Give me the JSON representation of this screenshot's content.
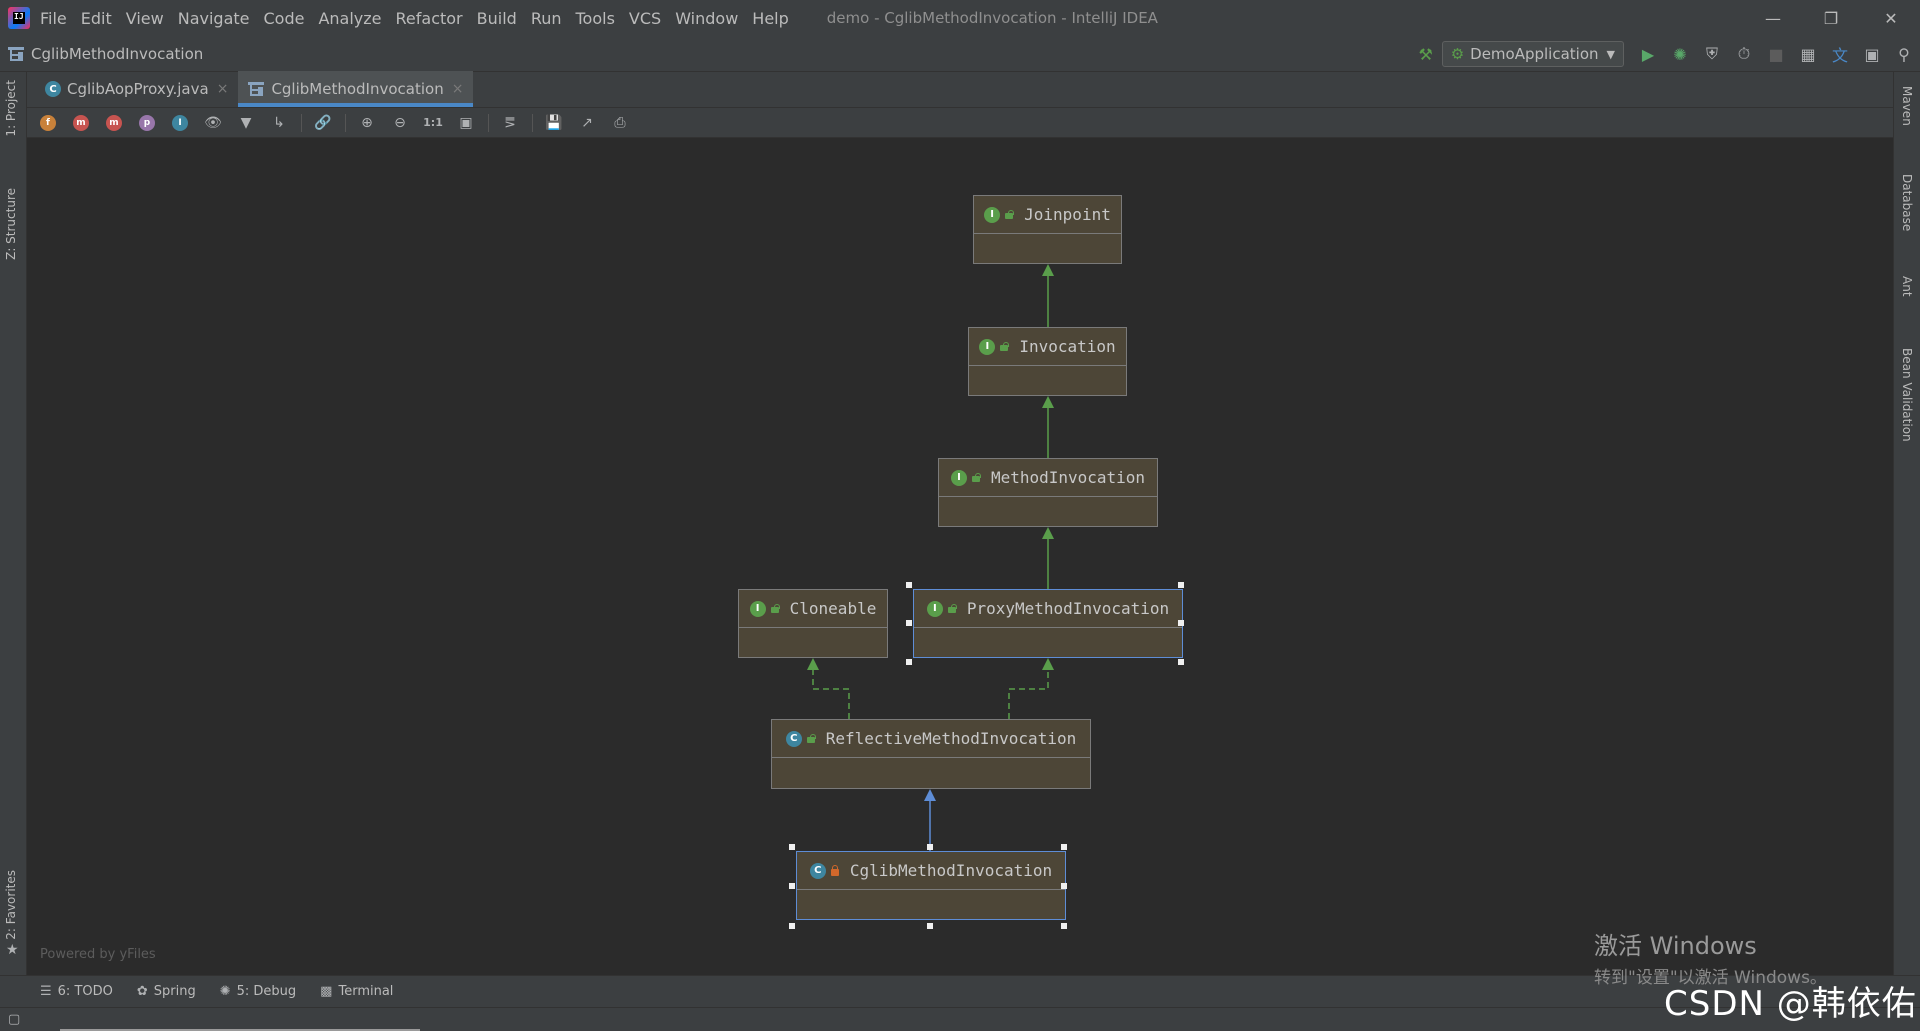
{
  "window": {
    "title": "demo - CglibMethodInvocation - IntelliJ IDEA",
    "menu": [
      "File",
      "Edit",
      "View",
      "Navigate",
      "Code",
      "Analyze",
      "Refactor",
      "Build",
      "Run",
      "Tools",
      "VCS",
      "Window",
      "Help"
    ]
  },
  "navbar": {
    "breadcrumb": "CglibMethodInvocation",
    "run_config": "DemoApplication"
  },
  "left_tools": [
    "1: Project",
    "Z: Structure",
    "2: Favorites"
  ],
  "right_tools": [
    "Maven",
    "Database",
    "Ant",
    "Bean Validation"
  ],
  "tabs": [
    {
      "label": "CglibAopProxy.java",
      "close": "×",
      "active": false
    },
    {
      "label": "CglibMethodInvocation",
      "close": "×",
      "active": true
    }
  ],
  "diagram_toolbar": {
    "icons": [
      "fields-icon",
      "constructors-icon",
      "methods-icon",
      "properties-icon",
      "inner-classes-icon",
      "visibility-icon",
      "filter-icon",
      "edge-mode-icon",
      "link-icon",
      "zoom-in-icon",
      "zoom-out-icon",
      "actual-size-icon",
      "fit-content-icon",
      "layout-icon",
      "save-icon",
      "export-icon",
      "print-icon"
    ],
    "letters": {
      "fields": "f",
      "constructors": "m",
      "methods": "m",
      "properties": "p",
      "inner": "I"
    },
    "actual_size_label": "1:1"
  },
  "diagram": {
    "nodes": [
      {
        "id": "joinpoint",
        "name": "Joinpoint",
        "kind": "interface",
        "kind_letter": "I",
        "visibility": "public"
      },
      {
        "id": "invocation",
        "name": "Invocation",
        "kind": "interface",
        "kind_letter": "I",
        "visibility": "public"
      },
      {
        "id": "method_invocation",
        "name": "MethodInvocation",
        "kind": "interface",
        "kind_letter": "I",
        "visibility": "public"
      },
      {
        "id": "cloneable",
        "name": "Cloneable",
        "kind": "interface",
        "kind_letter": "I",
        "visibility": "public"
      },
      {
        "id": "proxy_method_invocation",
        "name": "ProxyMethodInvocation",
        "kind": "interface",
        "kind_letter": "I",
        "visibility": "public",
        "selected": true
      },
      {
        "id": "reflective_method_invocation",
        "name": "ReflectiveMethodInvocation",
        "kind": "class",
        "kind_letter": "C",
        "visibility": "public"
      },
      {
        "id": "cglib_method_invocation",
        "name": "CglibMethodInvocation",
        "kind": "class",
        "kind_letter": "C",
        "visibility": "private",
        "selected": true
      }
    ],
    "edges": [
      {
        "from": "invocation",
        "to": "joinpoint",
        "type": "extends-interface"
      },
      {
        "from": "method_invocation",
        "to": "invocation",
        "type": "extends-interface"
      },
      {
        "from": "proxy_method_invocation",
        "to": "method_invocation",
        "type": "extends-interface"
      },
      {
        "from": "reflective_method_invocation",
        "to": "cloneable",
        "type": "implements"
      },
      {
        "from": "reflective_method_invocation",
        "to": "proxy_method_invocation",
        "type": "implements"
      },
      {
        "from": "cglib_method_invocation",
        "to": "reflective_method_invocation",
        "type": "extends-class"
      }
    ],
    "colors": {
      "interface_edge": "#5a9e4b",
      "class_edge": "#5e8dd6",
      "node_fill": "#4d4637",
      "selection": "#5e8dd6"
    }
  },
  "powered_by": "Powered by yFiles",
  "bottom_tools": [
    {
      "icon": "todo-icon",
      "label": "6: TODO"
    },
    {
      "icon": "spring-icon",
      "label": "Spring"
    },
    {
      "icon": "debug-icon",
      "label": "5: Debug"
    },
    {
      "icon": "terminal-icon",
      "label": "Terminal"
    }
  ],
  "watermark": {
    "activate_title": "激活 Windows",
    "activate_sub": "转到\"设置\"以激活 Windows。",
    "csdn": "CSDN @韩依佑"
  }
}
